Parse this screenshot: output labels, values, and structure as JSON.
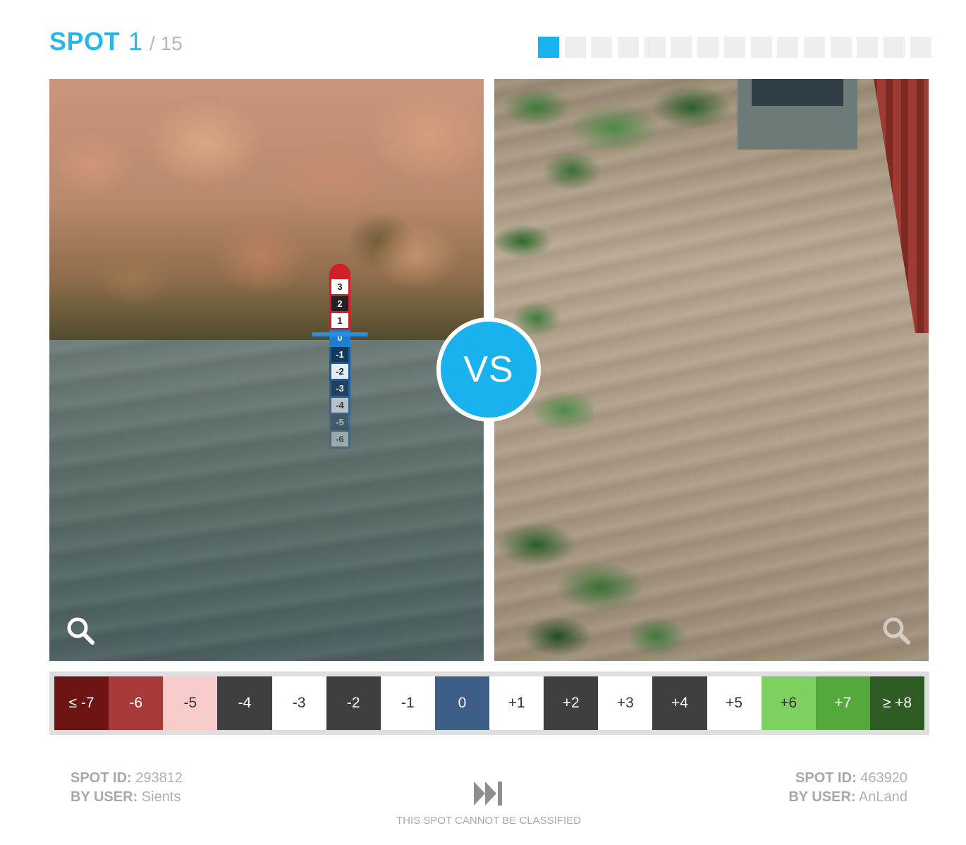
{
  "header": {
    "spot_label": "SPOT",
    "current": "1",
    "total": "/ 15"
  },
  "progress": {
    "segments": 15,
    "active_index": 0,
    "active_color": "#1ab2ee",
    "inactive_color": "#eeeeee"
  },
  "left_photo": {
    "gauge_labels": [
      "3",
      "2",
      "1",
      "0",
      "-1",
      "-2",
      "-3",
      "-4",
      "-5",
      "-6"
    ],
    "zoom_icon": "magnifier-icon"
  },
  "right_photo": {
    "zoom_icon": "magnifier-icon"
  },
  "vs_badge": {
    "label": "VS",
    "color": "#1ab2ee"
  },
  "scale": [
    {
      "label": "≤ -7",
      "bg": "#6e1414",
      "fg": "#ffffff"
    },
    {
      "label": "-6",
      "bg": "#a83939",
      "fg": "#ffffff"
    },
    {
      "label": "-5",
      "bg": "#f9cccc",
      "fg": "#333333"
    },
    {
      "label": "-4",
      "bg": "#3f3f3f",
      "fg": "#ffffff"
    },
    {
      "label": "-3",
      "bg": "#ffffff",
      "fg": "#333333"
    },
    {
      "label": "-2",
      "bg": "#3f3f3f",
      "fg": "#ffffff"
    },
    {
      "label": "-1",
      "bg": "#ffffff",
      "fg": "#333333"
    },
    {
      "label": "0",
      "bg": "#3d5f87",
      "fg": "#ffffff"
    },
    {
      "label": "+1",
      "bg": "#ffffff",
      "fg": "#333333"
    },
    {
      "label": "+2",
      "bg": "#3f3f3f",
      "fg": "#ffffff"
    },
    {
      "label": "+3",
      "bg": "#ffffff",
      "fg": "#333333"
    },
    {
      "label": "+4",
      "bg": "#3f3f3f",
      "fg": "#ffffff"
    },
    {
      "label": "+5",
      "bg": "#ffffff",
      "fg": "#333333"
    },
    {
      "label": "+6",
      "bg": "#7ed160",
      "fg": "#333333"
    },
    {
      "label": "+7",
      "bg": "#55a83a",
      "fg": "#ffffff"
    },
    {
      "label": "≥ +8",
      "bg": "#2f5c24",
      "fg": "#ffffff"
    }
  ],
  "left_meta": {
    "spot_id_label": "SPOT ID:",
    "spot_id": "293812",
    "user_label": "BY USER:",
    "user": "Sients"
  },
  "right_meta": {
    "spot_id_label": "SPOT ID:",
    "spot_id": "463920",
    "user_label": "BY USER:",
    "user": "AnLand"
  },
  "skip": {
    "icon": "fast-forward-icon",
    "label": "THIS SPOT CANNOT BE CLASSIFIED"
  }
}
